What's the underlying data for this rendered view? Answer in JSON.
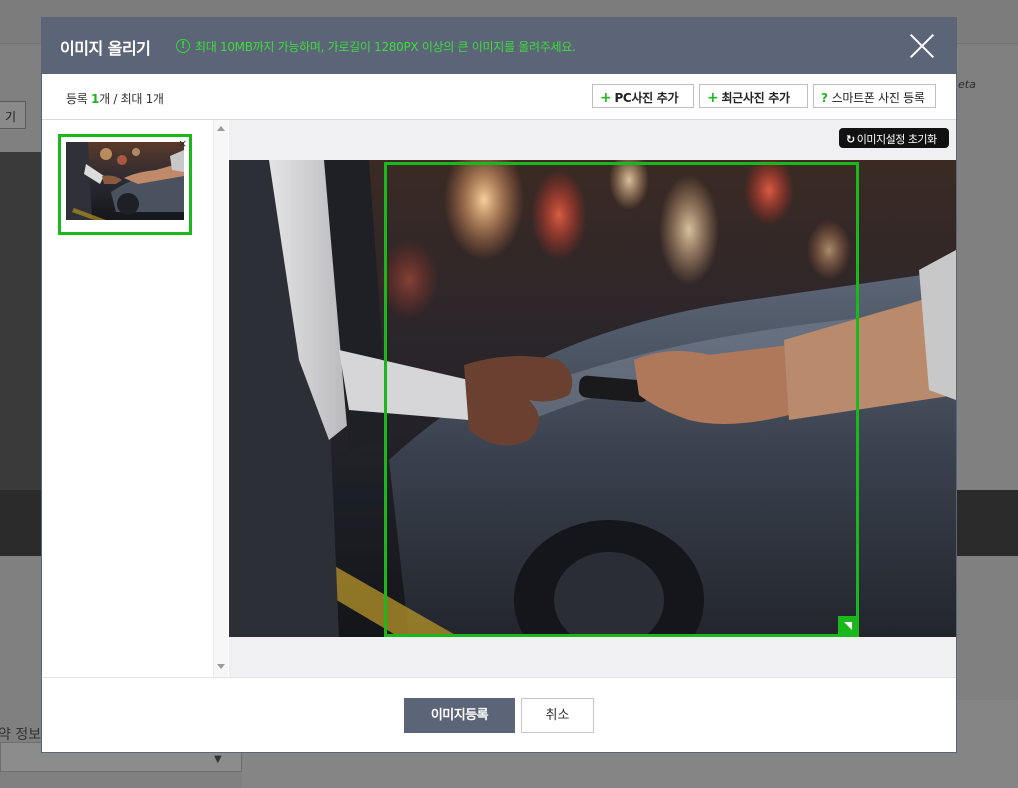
{
  "background": {
    "left_button_label": "기",
    "right_text": "eta",
    "bottom_label": "약 정보"
  },
  "modal": {
    "title": "이미지 올리기",
    "notice_icon": "!",
    "notice": "최대 10MB까지 가능하며, 가로길이 1280PX 이상의 큰 이미지를 올려주세요.",
    "colors": {
      "header": "#5c6478",
      "accent": "#1ab81a"
    }
  },
  "toolbar": {
    "count_prefix": "등록 ",
    "count_value": "1",
    "count_mid": "개 / 최대 ",
    "max_value": "1",
    "count_suffix": "개",
    "pc_button": "PC사진 추가",
    "recent_button": "최근사진 추가",
    "phone_button": "스마트폰 사진 등록",
    "plus_icon": "+",
    "question_icon": "?"
  },
  "editor": {
    "reset_button": "이미지설정 초기화",
    "reset_icon": "↻"
  },
  "thumbnail": {
    "remove_icon": "×"
  },
  "footer": {
    "register_button": "이미지등록",
    "cancel_button": "취소"
  }
}
